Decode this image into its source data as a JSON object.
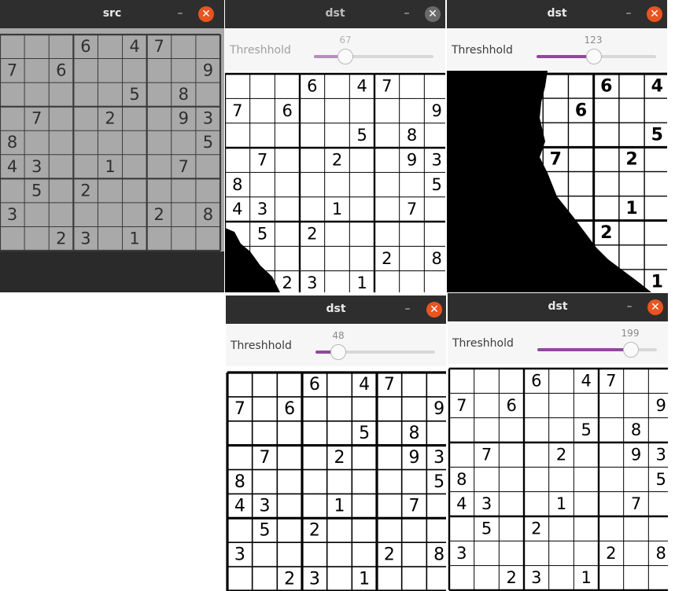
{
  "windows": [
    {
      "title": "src",
      "min_symbol": "–",
      "close_symbol": "✕"
    },
    {
      "title": "dst",
      "min_symbol": "–",
      "close_symbol": "✕",
      "trackbar": {
        "label": "Threshhold",
        "value": "67",
        "level": 0.26
      }
    },
    {
      "title": "dst",
      "min_symbol": "–",
      "close_symbol": "✕",
      "trackbar": {
        "label": "Threshhold",
        "value": "123",
        "level": 0.48
      }
    },
    {
      "title": "dst",
      "min_symbol": "–",
      "close_symbol": "✕",
      "trackbar": {
        "label": "Threshhold",
        "value": "48",
        "level": 0.19
      }
    },
    {
      "title": "dst",
      "min_symbol": "–",
      "close_symbol": "✕",
      "trackbar": {
        "label": "Threshhold",
        "value": "199",
        "level": 0.78
      }
    }
  ],
  "sudoku": {
    "src_rows": [
      [
        "",
        "",
        "",
        "6",
        "",
        "4",
        "7",
        "",
        ""
      ],
      [
        "7",
        "",
        "6",
        "",
        "",
        "",
        "",
        "",
        "9"
      ],
      [
        "",
        "",
        "",
        "",
        "",
        "5",
        "",
        "8",
        ""
      ],
      [
        "",
        "7",
        "",
        "",
        "2",
        "",
        "",
        "9",
        "3"
      ],
      [
        "8",
        "",
        "",
        "",
        "",
        "",
        "",
        "",
        "5"
      ],
      [
        "4",
        "3",
        "",
        "",
        "1",
        "",
        "",
        "7",
        ""
      ],
      [
        "",
        "5",
        "",
        "2",
        "",
        "",
        "",
        "",
        ""
      ],
      [
        "3",
        "",
        "",
        "",
        "",
        "",
        "2",
        "",
        "8"
      ],
      [
        "",
        "",
        "2",
        "3",
        "",
        "1",
        "",
        "",
        ""
      ]
    ]
  },
  "colors": {
    "accent": "#e95420",
    "slider_fill": "#8f4a9a",
    "titlebar": "#2e2e2e"
  },
  "icons": {
    "minimize": "minimize-icon",
    "close": "close-icon"
  }
}
